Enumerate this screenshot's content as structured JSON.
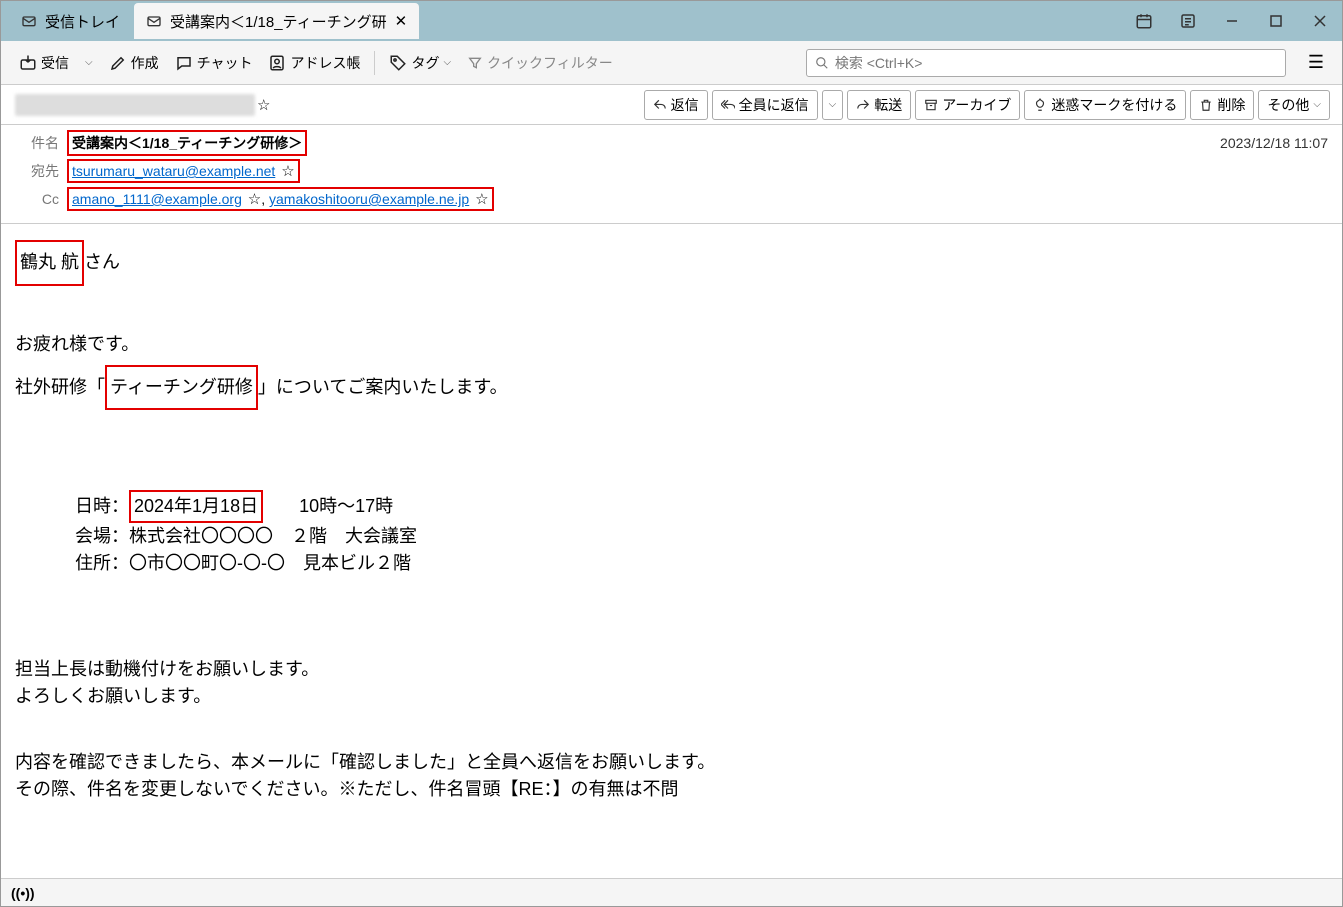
{
  "tabs": {
    "inbox": "受信トレイ",
    "message": "受講案内＜1/18_ティーチング研"
  },
  "toolbar": {
    "receive": "受信",
    "compose": "作成",
    "chat": "チャット",
    "addressbook": "アドレス帳",
    "tag": "タグ",
    "quickfilter": "クイックフィルター",
    "search_placeholder": "検索 <Ctrl+K>"
  },
  "actions": {
    "reply": "返信",
    "replyall": "全員に返信",
    "forward": "転送",
    "archive": "アーカイブ",
    "junk": "迷惑マークを付ける",
    "delete": "削除",
    "other": "その他"
  },
  "headers": {
    "subject_label": "件名",
    "subject_value": "受講案内＜1/18_ティーチング研修＞",
    "to_label": "宛先",
    "to_value": "tsurumaru_wataru@example.net",
    "cc_label": "Cc",
    "cc_value1": "amano_1111@example.org",
    "cc_value2": "yamakoshitooru@example.ne.jp",
    "cc_sep": ", ",
    "timestamp": "2023/12/18 11:07"
  },
  "body": {
    "greet_name": "鶴丸 航",
    "greet_suffix": "さん",
    "line2": "お疲れ様です。",
    "line3_pre": "社外研修「",
    "line3_red": "ティーチング研修",
    "line3_post": "」についてご案内いたします。",
    "sched_date_label": "日時：",
    "sched_date_red": "2024年1月18日",
    "sched_date_time": "　　10時～17時",
    "sched_venue": "会場：株式会社〇〇〇〇　２階　大会議室",
    "sched_addr": "住所：〇市〇〇町〇-〇-〇　見本ビル２階",
    "line_a": "担当上長は動機付けをお願いします。",
    "line_b": "よろしくお願いします。",
    "line_c": "内容を確認できましたら、本メールに「確認しました」と全員へ返信をお願いします。",
    "line_d": "その際、件名を変更しないでください。※ただし、件名冒頭【RE：】の有無は不問"
  }
}
